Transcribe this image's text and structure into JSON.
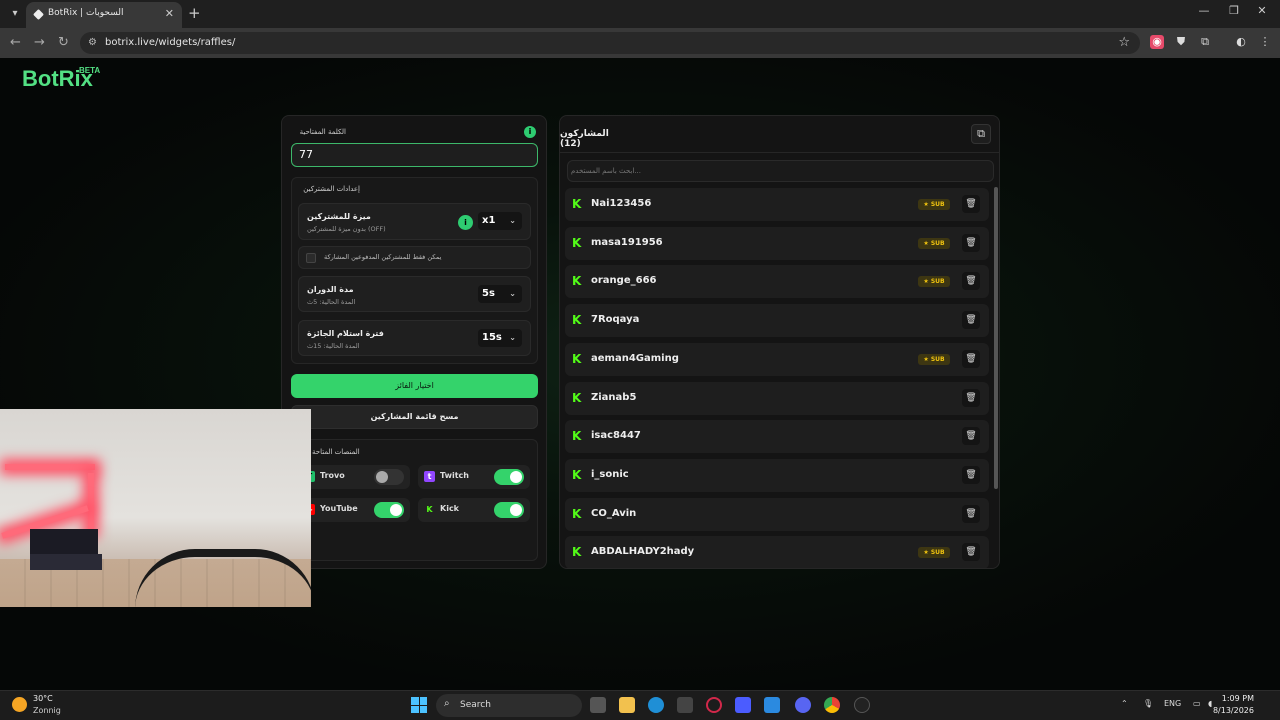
{
  "browser": {
    "tab_title": "BotRix | السحوبات",
    "url": "botrix.live/widgets/raffles/"
  },
  "logo": {
    "name": "BotRix",
    "badge": "BETA"
  },
  "keyword": {
    "label": "الكلمة المفتاحية",
    "value": "77"
  },
  "settings": {
    "title": "إعدادات المشتركين",
    "rows": [
      {
        "title": "ميزة للمشتركين",
        "subtitle": "بدون ميزة للمشتركين (OFF)",
        "value": "x1"
      },
      {
        "title": "مدة الدوران",
        "subtitle": "المدة الحالية: 5ث",
        "value": "5s"
      },
      {
        "title": "فترة استلام الجائزة",
        "subtitle": "المدة الحالية: 15ث",
        "value": "15s"
      }
    ],
    "paid_only_label": "يمكن فقط للمشتركين المدفوعين المشاركة"
  },
  "actions": {
    "pick_winner": "اختيار الفائز",
    "clear_list": "مسح قائمة المشاركين"
  },
  "platforms": {
    "title": "المنصات المتاحة",
    "items": [
      {
        "name": "Trovo",
        "enabled": false
      },
      {
        "name": "Twitch",
        "enabled": true
      },
      {
        "name": "YouTube",
        "enabled": true
      },
      {
        "name": "Kick",
        "enabled": true
      }
    ]
  },
  "participants": {
    "title": "المشاركون (12)",
    "search_placeholder": "ابحث باسم المستخدم...",
    "sub_label": "SUB",
    "list": [
      {
        "name": "Nai123456",
        "sub": true
      },
      {
        "name": "masa191956",
        "sub": true
      },
      {
        "name": "orange_666",
        "sub": true
      },
      {
        "name": "7Roqaya",
        "sub": false
      },
      {
        "name": "aeman4Gaming",
        "sub": true
      },
      {
        "name": "Zianab5",
        "sub": false
      },
      {
        "name": "isac8447",
        "sub": false
      },
      {
        "name": "i_sonic",
        "sub": false
      },
      {
        "name": "CO_Avin",
        "sub": false
      },
      {
        "name": "ABDALHADY2hady",
        "sub": true
      }
    ]
  },
  "taskbar": {
    "weather_temp": "30°C",
    "weather_desc": "Zonnig",
    "search": "Search",
    "lang": "ENG",
    "time": "1:09 PM",
    "date": "8/13/2026"
  },
  "colors": {
    "accent": "#34d36b",
    "kick": "#53fc18",
    "sub": "#f1c40f"
  }
}
